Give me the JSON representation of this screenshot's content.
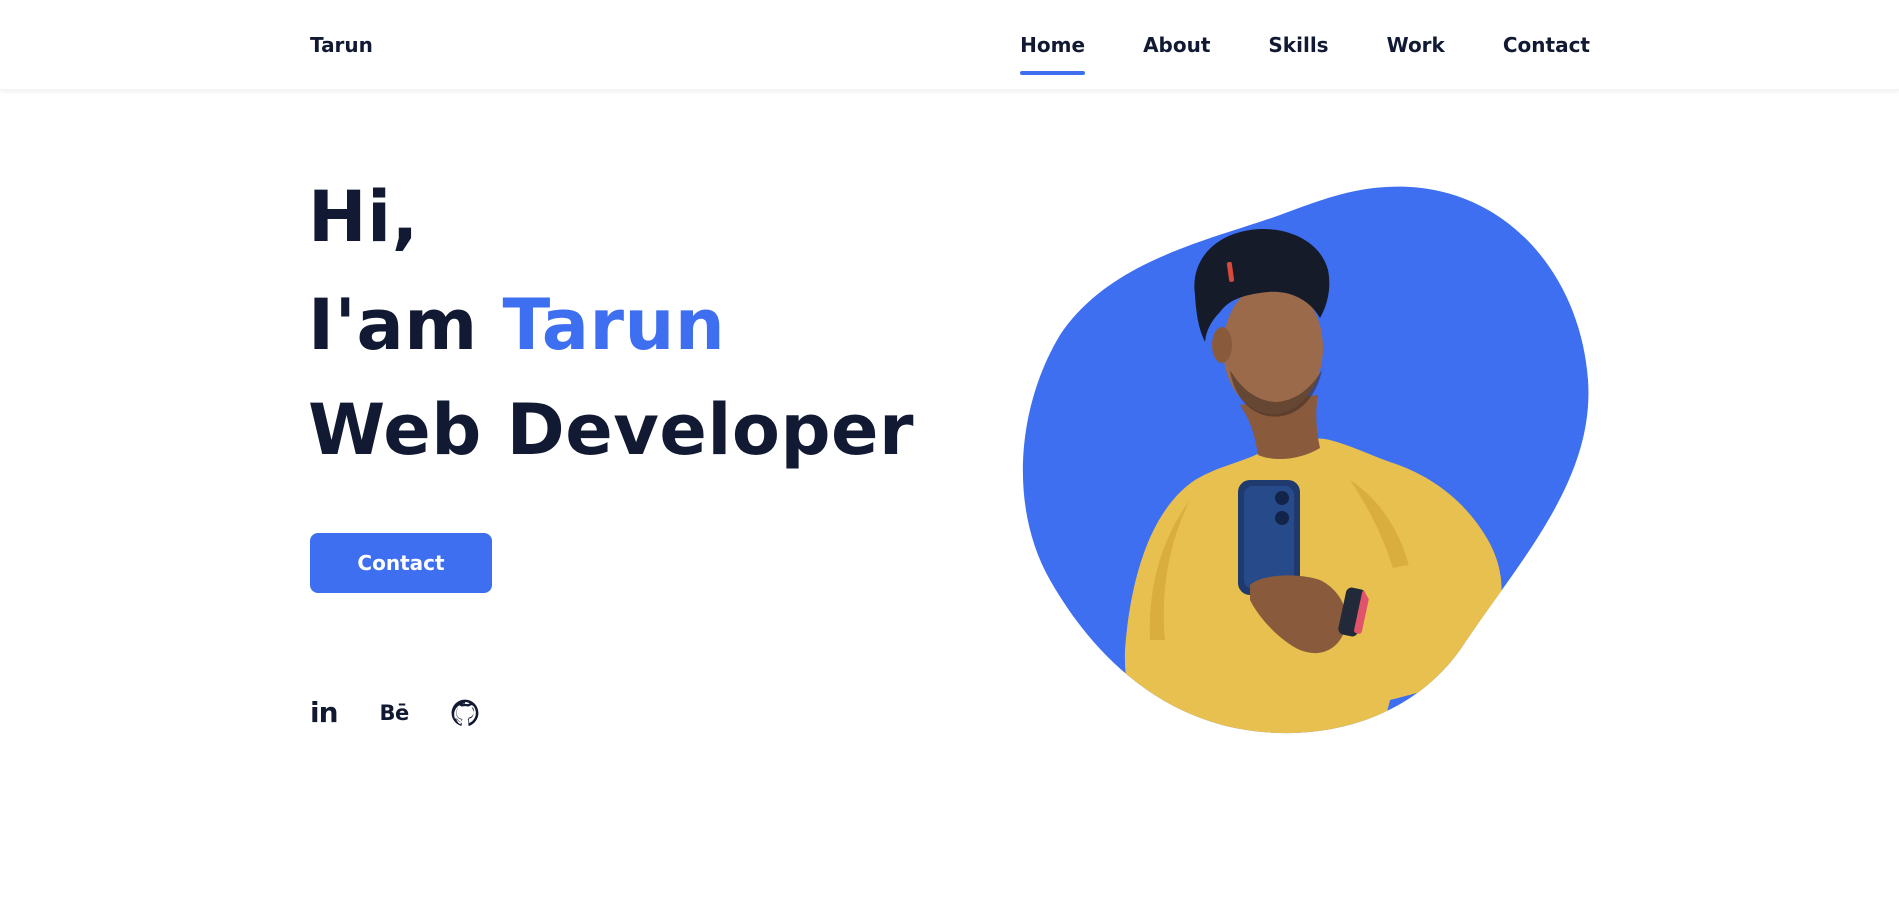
{
  "header": {
    "brand": "Tarun",
    "nav": [
      "Home",
      "About",
      "Skills",
      "Work",
      "Contact"
    ],
    "active_nav": "Home"
  },
  "hero": {
    "greeting": "Hi,",
    "intro_prefix": "I'am ",
    "name": "Tarun",
    "role": "Web Developer",
    "cta_label": "Contact"
  },
  "socials": [
    {
      "icon": "linkedin-icon",
      "glyph": "in"
    },
    {
      "icon": "behance-icon",
      "glyph": "Bē"
    },
    {
      "icon": "github-icon"
    }
  ],
  "colors": {
    "accent": "#3e6ff0",
    "text": "#121a33",
    "background": "#ffffff",
    "shirt": "#e8c04f"
  },
  "image": {
    "subject": "profile-photo"
  }
}
